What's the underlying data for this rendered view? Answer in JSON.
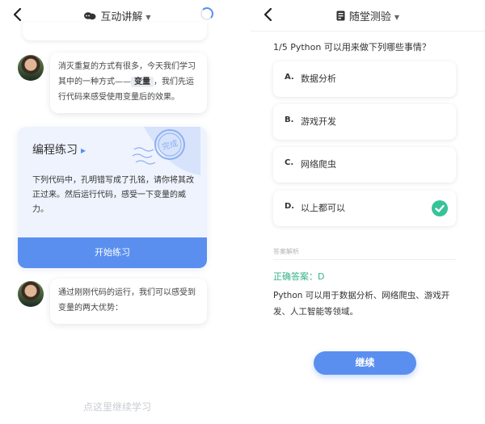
{
  "left": {
    "header": {
      "title": "互动讲解",
      "title_icon": "chat-bubbles-icon"
    },
    "messages": [
      {
        "parts": [
          "消灭重复的方式有很多，今天我们学习其中的一种方式——",
          "变量",
          "，我们先运行代码来感受使用变量后的效果。"
        ]
      },
      {
        "text": "通过刚刚代码的运行，我们可以感受到变量的两大优势："
      }
    ],
    "practice_card": {
      "title": "编程练习",
      "stamp": "完成",
      "description": "下列代码中，孔明错写成了孔铭，请你将其改正过来。然后运行代码，感受一下变量的威力。",
      "button": "开始练习"
    },
    "continue_link": "点这里继续学习"
  },
  "right": {
    "header": {
      "title": "随堂测验",
      "title_icon": "quiz-icon"
    },
    "question": "1/5 Python 可以用来做下列哪些事情？",
    "options": [
      {
        "letter": "A.",
        "text": "数据分析"
      },
      {
        "letter": "B.",
        "text": "游戏开发"
      },
      {
        "letter": "C.",
        "text": "网络爬虫"
      },
      {
        "letter": "D.",
        "text": "以上都可以"
      }
    ],
    "selected_option": "D",
    "answer_section_label": "答案解析",
    "correct_answer": "正确答案：D",
    "explanation": "Python 可以用于数据分析、网络爬虫、游戏开发、人工智能等领域。",
    "next_button": "继续"
  },
  "colors": {
    "accent": "#5a8ff0",
    "success": "#36c39a",
    "card_bg": "#eef3fd"
  }
}
